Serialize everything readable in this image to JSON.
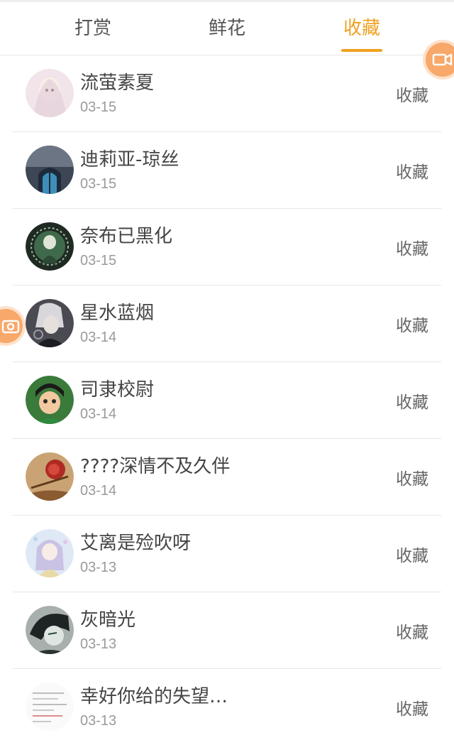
{
  "tabs": [
    {
      "label": "打赏",
      "active": false
    },
    {
      "label": "鲜花",
      "active": false
    },
    {
      "label": "收藏",
      "active": true
    }
  ],
  "colors": {
    "accent": "#f0a020",
    "float_button": "#f7a86a"
  },
  "floating_buttons": [
    {
      "icon": "video-camera-icon"
    },
    {
      "icon": "camera-icon"
    }
  ],
  "rows": [
    {
      "name": "流萤素夏",
      "date": "03-15",
      "action": "收藏"
    },
    {
      "name": "迪莉亚-琼丝",
      "date": "03-15",
      "action": "收藏"
    },
    {
      "name": "奈布已黑化",
      "date": "03-15",
      "action": "收藏"
    },
    {
      "name": "星水蓝烟",
      "date": "03-14",
      "action": "收藏"
    },
    {
      "name": "司隶校尉",
      "date": "03-14",
      "action": "收藏"
    },
    {
      "name": "????深情不及久伴",
      "date": "03-14",
      "action": "收藏"
    },
    {
      "name": "艾离是殓吹呀",
      "date": "03-13",
      "action": "收藏"
    },
    {
      "name": "灰暗光",
      "date": "03-13",
      "action": "收藏"
    },
    {
      "name": "幸好你给的失望…",
      "date": "03-13",
      "action": "收藏"
    }
  ]
}
